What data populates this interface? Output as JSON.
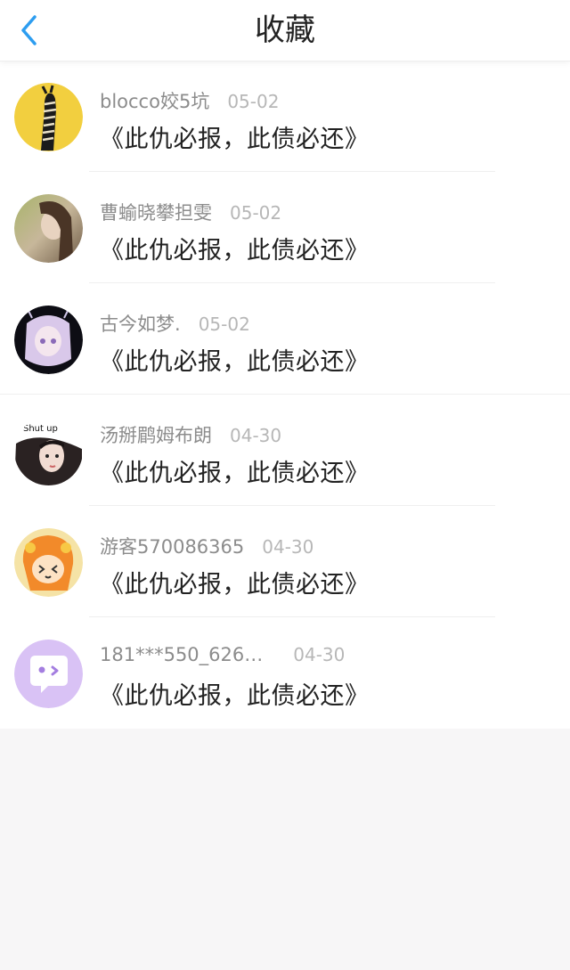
{
  "header": {
    "title": "收藏",
    "back_icon": "chevron-left-icon",
    "accent": "#2d9df0"
  },
  "items": [
    {
      "user": "blocco姣5坑",
      "date": "05-02",
      "content": "《此仇必报，此债必还》",
      "avatar": "zebra-avatar"
    },
    {
      "user": "曹蝓晓攀担雯",
      "date": "05-02",
      "content": "《此仇必报，此债必还》",
      "avatar": "girl-photo-avatar"
    },
    {
      "user": "古今如梦.",
      "date": "05-02",
      "content": "《此仇必报，此债必还》",
      "avatar": "anime-girl-avatar"
    },
    {
      "user": "汤掰鹛姆布朗",
      "date": "04-30",
      "content": "《此仇必报，此债必还》",
      "avatar": "shut-up-avatar",
      "avatar_text": "Shut up"
    },
    {
      "user": "游客570086365",
      "date": "04-30",
      "content": "《此仇必报，此债必还》",
      "avatar": "cartoon-avatar"
    },
    {
      "user": "181***550_626…",
      "date": "04-30",
      "content": "《此仇必报，此债必还》",
      "avatar": "default-chat-avatar"
    }
  ]
}
